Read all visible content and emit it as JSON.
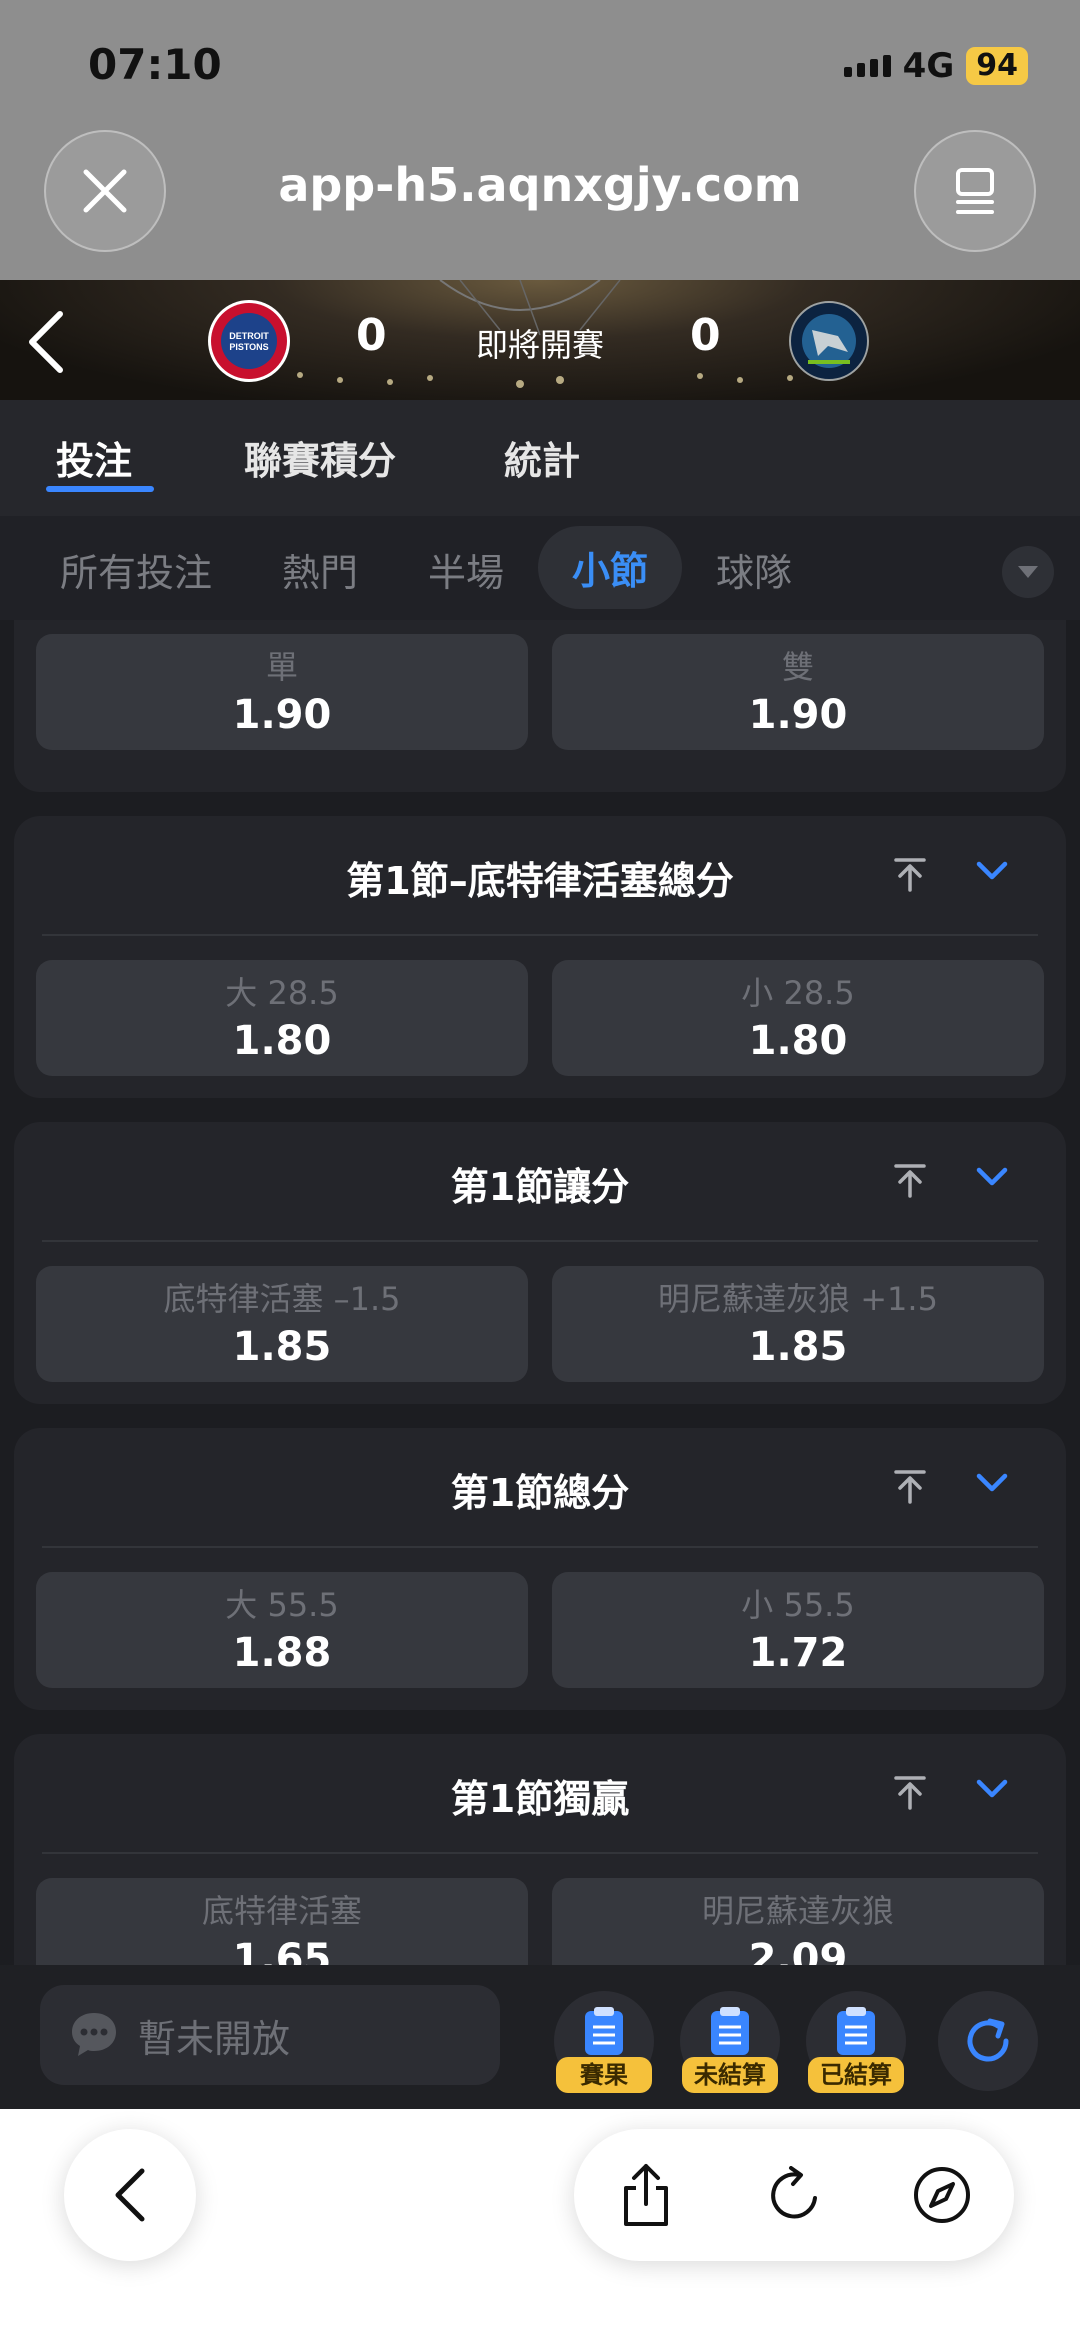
{
  "status": {
    "time": "07:10",
    "network": "4G",
    "battery": "94"
  },
  "browser": {
    "url": "app-h5.aqnxgjy.com"
  },
  "match": {
    "home_score": "0",
    "away_score": "0",
    "status": "即將開賽",
    "home_logo_text": "DETROIT PISTONS"
  },
  "tabs": [
    {
      "label": "投注"
    },
    {
      "label": "聯賽積分"
    },
    {
      "label": "統計"
    }
  ],
  "subtabs": [
    {
      "label": "所有投注"
    },
    {
      "label": "熱門"
    },
    {
      "label": "半場"
    },
    {
      "label": "小節"
    },
    {
      "label": "球隊"
    }
  ],
  "markets": [
    {
      "title": "",
      "odds": [
        {
          "label": "單",
          "value": "1.90"
        },
        {
          "label": "雙",
          "value": "1.90"
        }
      ]
    },
    {
      "title": "第1節–底特律活塞總分",
      "odds": [
        {
          "label": "大 28.5",
          "value": "1.80"
        },
        {
          "label": "小 28.5",
          "value": "1.80"
        }
      ]
    },
    {
      "title": "第1節讓分",
      "odds": [
        {
          "label": "底特律活塞 –1.5",
          "value": "1.85"
        },
        {
          "label": "明尼蘇達灰狼 +1.5",
          "value": "1.85"
        }
      ]
    },
    {
      "title": "第1節總分",
      "odds": [
        {
          "label": "大 55.5",
          "value": "1.88"
        },
        {
          "label": "小 55.5",
          "value": "1.72"
        }
      ]
    },
    {
      "title": "第1節獨贏",
      "odds": [
        {
          "label": "底特律活塞",
          "value": "1.65"
        },
        {
          "label": "明尼蘇達灰狼",
          "value": "2.09"
        }
      ]
    }
  ],
  "appbar": {
    "chat_placeholder": "暫未開放",
    "shortcuts": [
      {
        "label": "賽果"
      },
      {
        "label": "未結算"
      },
      {
        "label": "已結算"
      }
    ]
  },
  "colors": {
    "accent": "#3a86ff",
    "badge": "#f5c13b",
    "card": "#24252a",
    "odd_button": "#36383e"
  },
  "icons": [
    "close-icon",
    "tabs-icon",
    "back-chevron-icon",
    "pin-top-icon",
    "collapse-chevron-icon",
    "chat-icon",
    "clipboard-icon",
    "refresh-icon",
    "share-icon",
    "reload-icon",
    "compass-icon"
  ]
}
